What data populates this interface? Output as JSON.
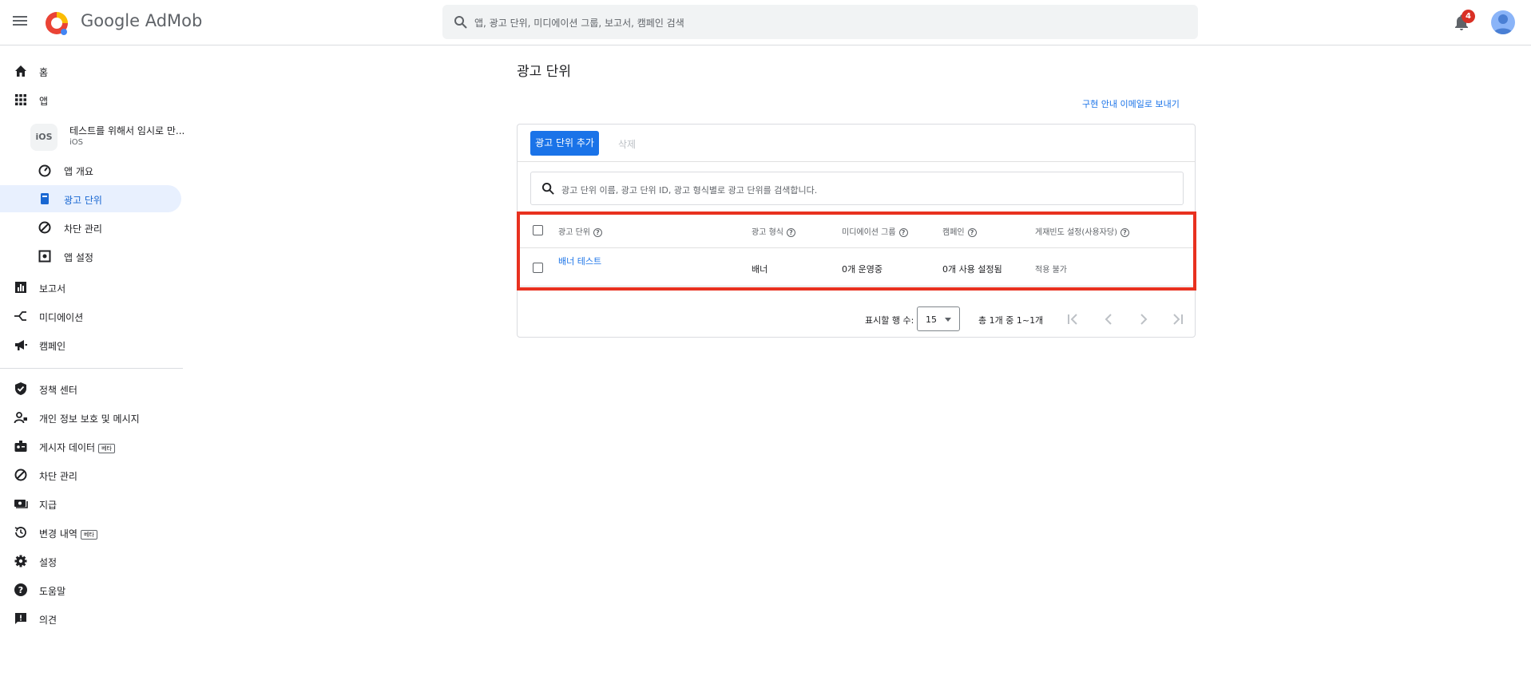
{
  "header": {
    "brand": "Google AdMob",
    "search_placeholder": "앱, 광고 단위, 미디에이션 그룹, 보고서, 캠페인 검색",
    "notification_count": "4"
  },
  "sidebar": {
    "home": "홈",
    "apps": "앱",
    "app": {
      "icon_text": "iOS",
      "name": "테스트를 위해서 임시로 만...",
      "platform": "iOS"
    },
    "app_overview": "앱 개요",
    "ad_units": "광고 단위",
    "blocking_app": "차단 관리",
    "app_settings": "앱 설정",
    "reports": "보고서",
    "mediation": "미디에이션",
    "campaigns": "캠페인",
    "policy_center": "정책 센터",
    "privacy": "개인 정보 보호 및 메시지",
    "publisher_data": "게시자 데이터",
    "publisher_data_badge": "베타",
    "blocking": "차단 관리",
    "payments": "지급",
    "change_history": "변경 내역",
    "change_history_badge": "베타",
    "settings": "설정",
    "help": "도움말",
    "feedback": "의견"
  },
  "main": {
    "title": "광고 단위",
    "email_link": "구현 안내 이메일로 보내기",
    "add_button": "광고 단위 추가",
    "delete_button": "삭제",
    "search_placeholder": "광고 단위 이름, 광고 단위 ID, 광고 형식별로 광고 단위를 검색합니다.",
    "columns": {
      "ad_unit": "광고 단위",
      "format": "광고 형식",
      "mediation_group": "미디에이션 그룹",
      "campaign": "캠페인",
      "frequency_cap": "게재빈도 설정(사용자당)"
    },
    "rows": [
      {
        "ad_unit": "배너 테스트",
        "format": "배너",
        "mediation_group": "0개 운영중",
        "campaign": "0개 사용 설정됨",
        "frequency_cap": "적용 불가"
      }
    ],
    "pagination": {
      "rows_label": "표시할 행 수:",
      "rows_value": "15",
      "range": "총 1개 중 1~1개"
    }
  },
  "colors": {
    "accent": "#1a73e8",
    "active_bg": "#e8f0fe",
    "highlight": "#e8311f",
    "badge": "#d93025"
  }
}
